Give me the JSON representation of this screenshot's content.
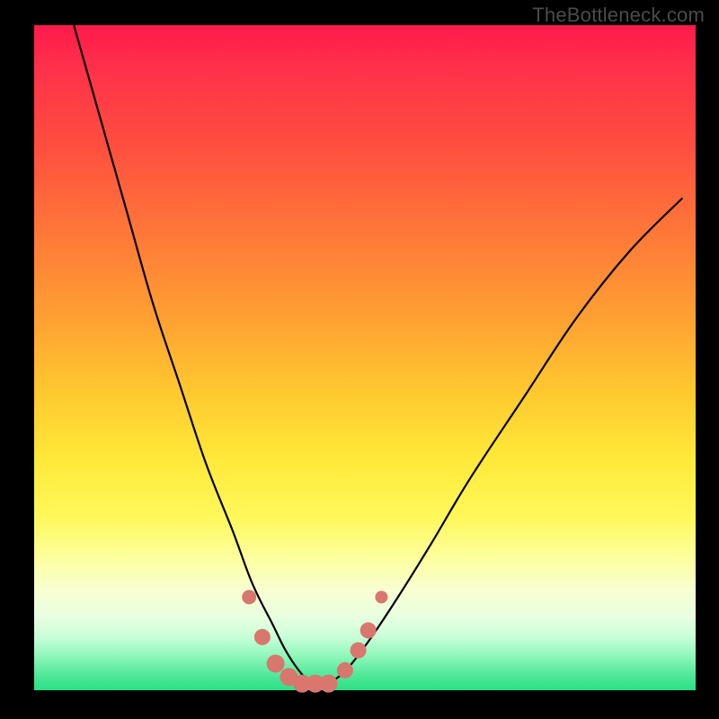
{
  "watermark": "TheBottleneck.com",
  "chart_data": {
    "type": "line",
    "title": "",
    "xlabel": "",
    "ylabel": "",
    "xlim": [
      0,
      100
    ],
    "ylim": [
      0,
      100
    ],
    "grid": false,
    "legend": false,
    "gradient_stops": [
      {
        "pos": 0,
        "color": "#ff1a4b"
      },
      {
        "pos": 18,
        "color": "#ff4e3f"
      },
      {
        "pos": 44,
        "color": "#ffa032"
      },
      {
        "pos": 65,
        "color": "#ffe838"
      },
      {
        "pos": 85,
        "color": "#f8ffd2"
      },
      {
        "pos": 95,
        "color": "#8cf6b8"
      },
      {
        "pos": 100,
        "color": "#2adf84"
      }
    ],
    "series": [
      {
        "name": "bottleneck-curve",
        "x": [
          6,
          10,
          14,
          18,
          22,
          26,
          30,
          33,
          36,
          38,
          40,
          42,
          44,
          46,
          48,
          51,
          55,
          60,
          66,
          74,
          82,
          90,
          98
        ],
        "y": [
          100,
          86,
          72,
          58,
          46,
          34,
          24,
          16,
          10,
          6,
          3,
          1,
          1,
          2,
          4,
          8,
          14,
          22,
          32,
          44,
          56,
          66,
          74
        ]
      }
    ],
    "markers": {
      "name": "marker-dots",
      "color": "#d9766e",
      "points": [
        {
          "x": 32.5,
          "y": 14,
          "r": 8
        },
        {
          "x": 34.5,
          "y": 8,
          "r": 9
        },
        {
          "x": 36.5,
          "y": 4,
          "r": 10
        },
        {
          "x": 38.5,
          "y": 2,
          "r": 10
        },
        {
          "x": 40.5,
          "y": 1,
          "r": 10
        },
        {
          "x": 42.5,
          "y": 1,
          "r": 10
        },
        {
          "x": 44.5,
          "y": 1,
          "r": 10
        },
        {
          "x": 47.0,
          "y": 3,
          "r": 9
        },
        {
          "x": 49.0,
          "y": 6,
          "r": 9
        },
        {
          "x": 50.5,
          "y": 9,
          "r": 9
        },
        {
          "x": 52.5,
          "y": 14,
          "r": 7
        }
      ]
    }
  }
}
